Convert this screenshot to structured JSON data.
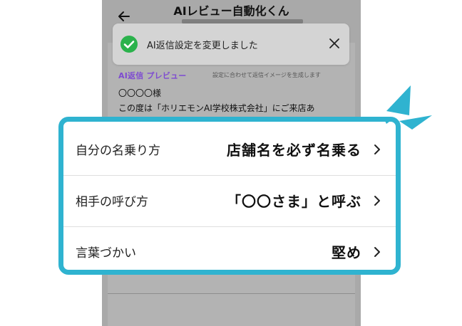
{
  "app": {
    "title": "AIレビュー自動化くん"
  },
  "toast": {
    "message": "AI返信設定を変更しました"
  },
  "preview": {
    "label": "AI返信 プレビュー",
    "note": "設定に合わせて返信イメージを生成します",
    "recipient": "〇〇〇〇様",
    "body": "この度は「ホリエモンAI学校株式会社」にご来店あ"
  },
  "settings": [
    {
      "label": "自分の名乗り方",
      "value": "店舗名を必ず名乗る"
    },
    {
      "label": "相手の呼び方",
      "value": "「〇〇さま」と呼ぶ"
    },
    {
      "label": "言葉づかい",
      "value": "堅め"
    }
  ],
  "colors": {
    "accent": "#2fb3d0",
    "success": "#2bb24c",
    "preview_label": "#7e4bd1"
  },
  "icons": [
    "back-arrow-icon",
    "check-circle-icon",
    "close-icon",
    "chevron-right-icon",
    "sparkle-icon"
  ]
}
